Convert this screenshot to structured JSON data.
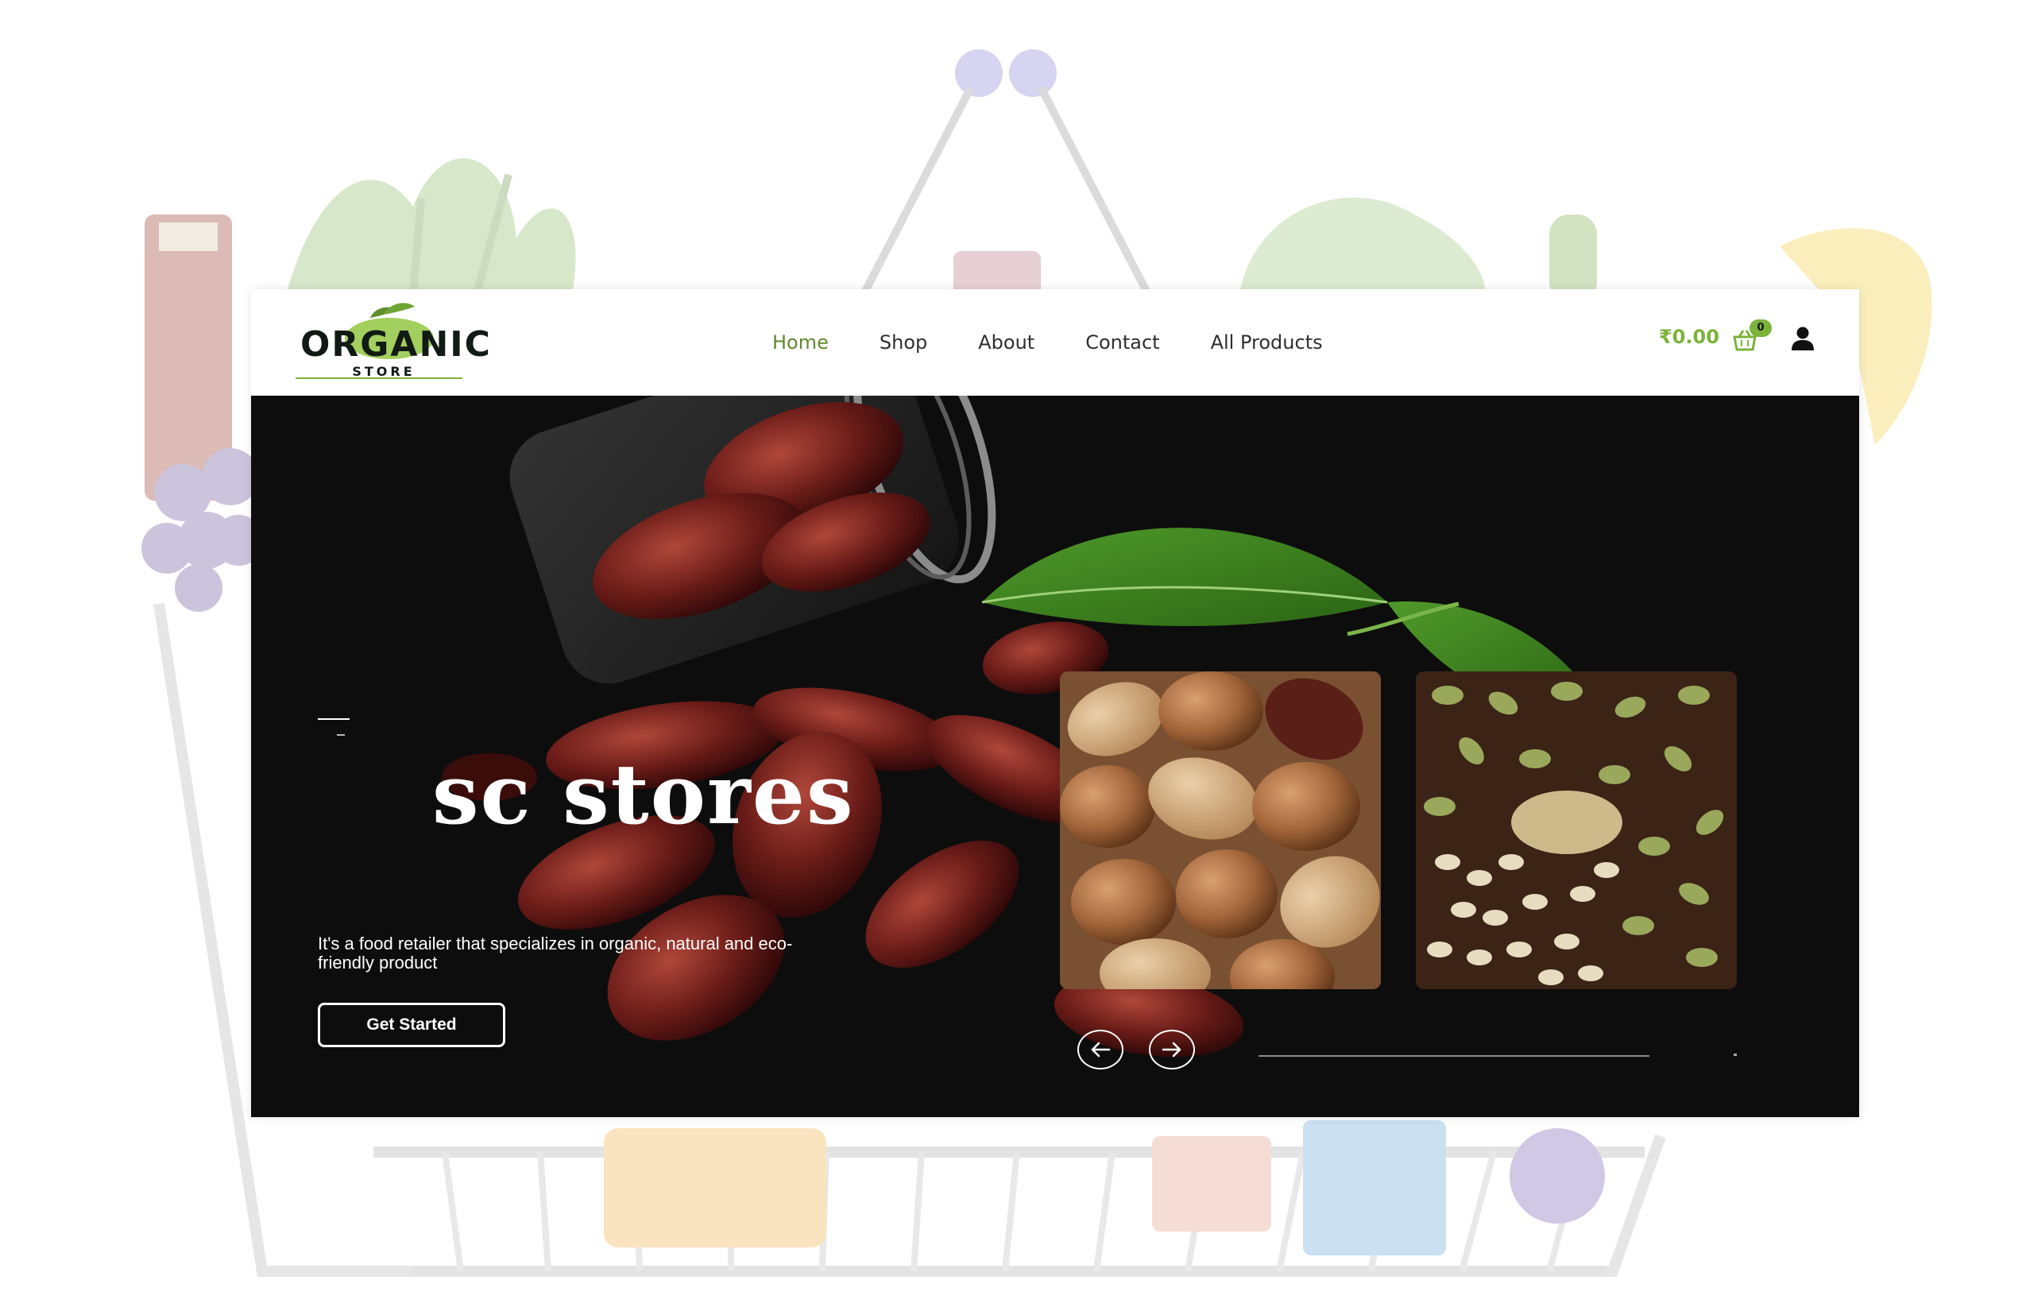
{
  "colors": {
    "accent_green": "#7bb33a",
    "nav_active": "#5e8a2c",
    "hero_bg": "#0d0d0d",
    "text_light": "#ffffff"
  },
  "logo": {
    "word": "ORGANIC",
    "sub": "STORE",
    "icon": "leaf-icon"
  },
  "nav": {
    "items": [
      {
        "label": "Home",
        "active": true
      },
      {
        "label": "Shop",
        "active": false
      },
      {
        "label": "About",
        "active": false
      },
      {
        "label": "Contact",
        "active": false
      },
      {
        "label": "All Products",
        "active": false
      }
    ]
  },
  "cart": {
    "total": "₹0.00",
    "count": "0",
    "icon": "basket-icon"
  },
  "account": {
    "icon": "user-icon"
  },
  "hero": {
    "title": "sc stores",
    "description": "It's a food retailer that specializes in organic, natural and eco-friendly product",
    "cta_label": "Get Started",
    "prev_icon": "arrow-left-icon",
    "next_icon": "arrow-right-icon",
    "cards": [
      {
        "name": "nuts-image"
      },
      {
        "name": "seeds-image"
      }
    ]
  }
}
